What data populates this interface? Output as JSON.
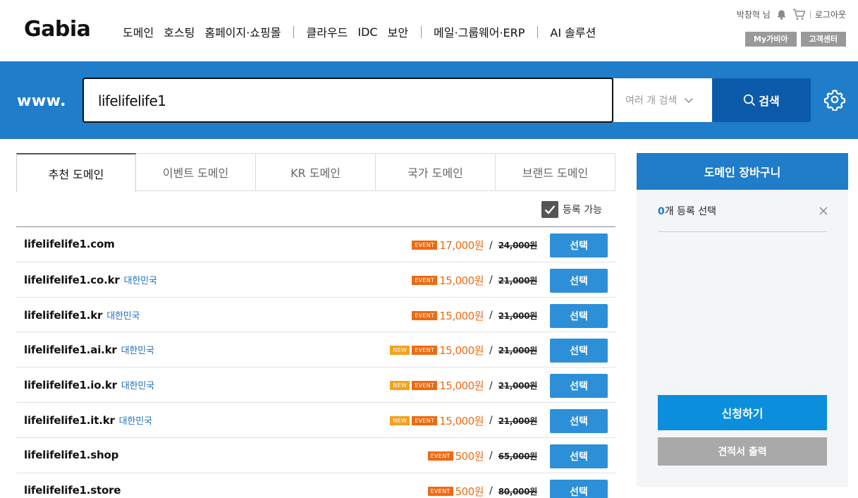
{
  "header": {
    "logo": "Gabia",
    "nav": [
      {
        "label": "도메인"
      },
      {
        "label": "호스팅"
      },
      {
        "label": "홈페이지·쇼핑몰"
      },
      {
        "label": "클라우드"
      },
      {
        "label": "IDC"
      },
      {
        "label": "보안"
      },
      {
        "label": "메일·그룹웨어·ERP"
      },
      {
        "label": "AI 솔루션"
      }
    ],
    "user": "박창혁 님",
    "logout": "로그아웃",
    "mygabia": "My가비아",
    "support": "고객센터"
  },
  "search": {
    "prefix": "www.",
    "value": "lifelifelife1",
    "multi_label": "여러 개 검색",
    "button_label": "검색"
  },
  "tabs": [
    {
      "label": "추천 도메인",
      "active": true
    },
    {
      "label": "이벤트 도메인"
    },
    {
      "label": "KR 도메인"
    },
    {
      "label": "국가 도메인"
    },
    {
      "label": "브랜드 도메인"
    }
  ],
  "filter": {
    "label": "등록 가능",
    "checked": true
  },
  "results": [
    {
      "name": "lifelifelife1.com",
      "country": "",
      "badges": [
        "EVENT"
      ],
      "price": "17,000원",
      "original": "24,000원",
      "button": "선택"
    },
    {
      "name": "lifelifelife1.co.kr",
      "country": "대한민국",
      "badges": [
        "EVENT"
      ],
      "price": "15,000원",
      "original": "21,000원",
      "button": "선택"
    },
    {
      "name": "lifelifelife1.kr",
      "country": "대한민국",
      "badges": [
        "EVENT"
      ],
      "price": "15,000원",
      "original": "21,000원",
      "button": "선택"
    },
    {
      "name": "lifelifelife1.ai.kr",
      "country": "대한민국",
      "badges": [
        "NEW",
        "EVENT"
      ],
      "price": "15,000원",
      "original": "21,000원",
      "button": "선택"
    },
    {
      "name": "lifelifelife1.io.kr",
      "country": "대한민국",
      "badges": [
        "NEW",
        "EVENT"
      ],
      "price": "15,000원",
      "original": "21,000원",
      "button": "선택"
    },
    {
      "name": "lifelifelife1.it.kr",
      "country": "대한민국",
      "badges": [
        "NEW",
        "EVENT"
      ],
      "price": "15,000원",
      "original": "21,000원",
      "button": "선택"
    },
    {
      "name": "lifelifelife1.shop",
      "country": "",
      "badges": [
        "EVENT"
      ],
      "price": "500원",
      "original": "65,000원",
      "button": "선택"
    },
    {
      "name": "lifelifelife1.store",
      "country": "",
      "badges": [
        "EVENT"
      ],
      "price": "500원",
      "original": "80,000원",
      "button": "선택"
    }
  ],
  "cart": {
    "title": "도메인 장바구니",
    "count": "0",
    "count_suffix": "개 등록 선택",
    "apply": "신청하기",
    "quote": "견적서 출력"
  },
  "colors": {
    "brand_blue": "#1f7dc9",
    "search_button": "#0c5bab",
    "event_orange": "#ee6a12",
    "new_yellow": "#f4a21c",
    "select_button": "#2d8fd8"
  }
}
